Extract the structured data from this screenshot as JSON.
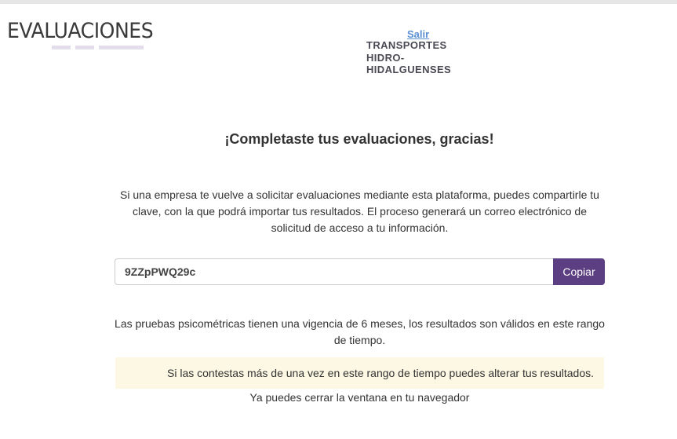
{
  "header": {
    "logo_text": "EVALUACIONES",
    "logout_label": "Salir",
    "company_name": "TRANSPORTES HIDRO-HIDALGUENSES"
  },
  "main": {
    "heading": "¡Completaste tus evaluaciones, gracias!",
    "share_text": "Si una empresa te vuelve a solicitar evaluaciones mediante esta plataforma, puedes compartirle tu clave, con la que podrá importar tus resultados. El proceso generará un correo electrónico de solicitud de acceso a tu información.",
    "access_key": "9ZZpPWQ29c",
    "copy_label": "Copiar",
    "validity_text": "Las pruebas psicométricas tienen una vigencia de 6 meses, los resultados son válidos en este rango de tiempo.",
    "warning_text": "Si las contestas más de una vez en este rango de tiempo puedes alterar tus resultados.",
    "close_text": "Ya puedes cerrar la ventana en tu navegador"
  },
  "colors": {
    "accent": "#5c3f82",
    "link": "#5b8fd6",
    "warning_bg": "#fcf8e3",
    "logo_bars": "#e3ddec"
  }
}
